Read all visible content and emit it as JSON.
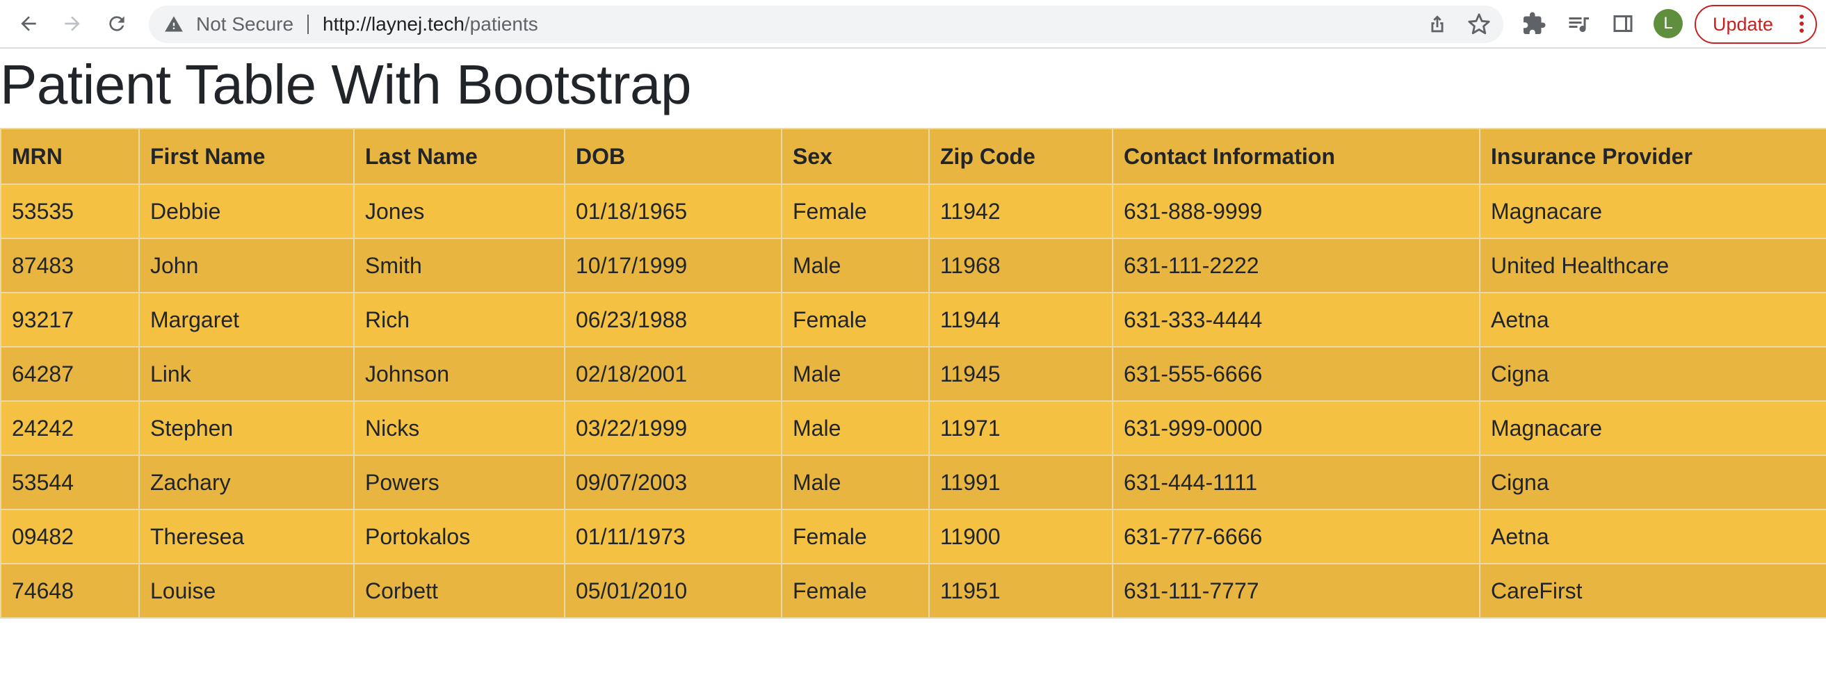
{
  "browser": {
    "security_label": "Not Secure",
    "url_host": "http://laynej.tech",
    "url_path": "/patients",
    "avatar_letter": "L",
    "update_label": "Update"
  },
  "page": {
    "title": "Patient Table With Bootstrap"
  },
  "table": {
    "headers": [
      "MRN",
      "First Name",
      "Last Name",
      "DOB",
      "Sex",
      "Zip Code",
      "Contact Information",
      "Insurance Provider"
    ],
    "rows": [
      [
        "53535",
        "Debbie",
        "Jones",
        "01/18/1965",
        "Female",
        "11942",
        "631-888-9999",
        "Magnacare"
      ],
      [
        "87483",
        "John",
        "Smith",
        "10/17/1999",
        "Male",
        "11968",
        "631-111-2222",
        "United Healthcare"
      ],
      [
        "93217",
        "Margaret",
        "Rich",
        "06/23/1988",
        "Female",
        "11944",
        "631-333-4444",
        "Aetna"
      ],
      [
        "64287",
        "Link",
        "Johnson",
        "02/18/2001",
        "Male",
        "11945",
        "631-555-6666",
        "Cigna"
      ],
      [
        "24242",
        "Stephen",
        "Nicks",
        "03/22/1999",
        "Male",
        "11971",
        "631-999-0000",
        "Magnacare"
      ],
      [
        "53544",
        "Zachary",
        "Powers",
        "09/07/2003",
        "Male",
        "11991",
        "631-444-1111",
        "Cigna"
      ],
      [
        "09482",
        "Theresea",
        "Portokalos",
        "01/11/1973",
        "Female",
        "11900",
        "631-777-6666",
        "Aetna"
      ],
      [
        "74648",
        "Louise",
        "Corbett",
        "05/01/2010",
        "Female",
        "11951",
        "631-111-7777",
        "CareFirst"
      ]
    ]
  },
  "colors": {
    "row_light": "#f4c143",
    "row_dark": "#e8b640",
    "update_accent": "#c5221f",
    "avatar_bg": "#5f8f3c"
  }
}
